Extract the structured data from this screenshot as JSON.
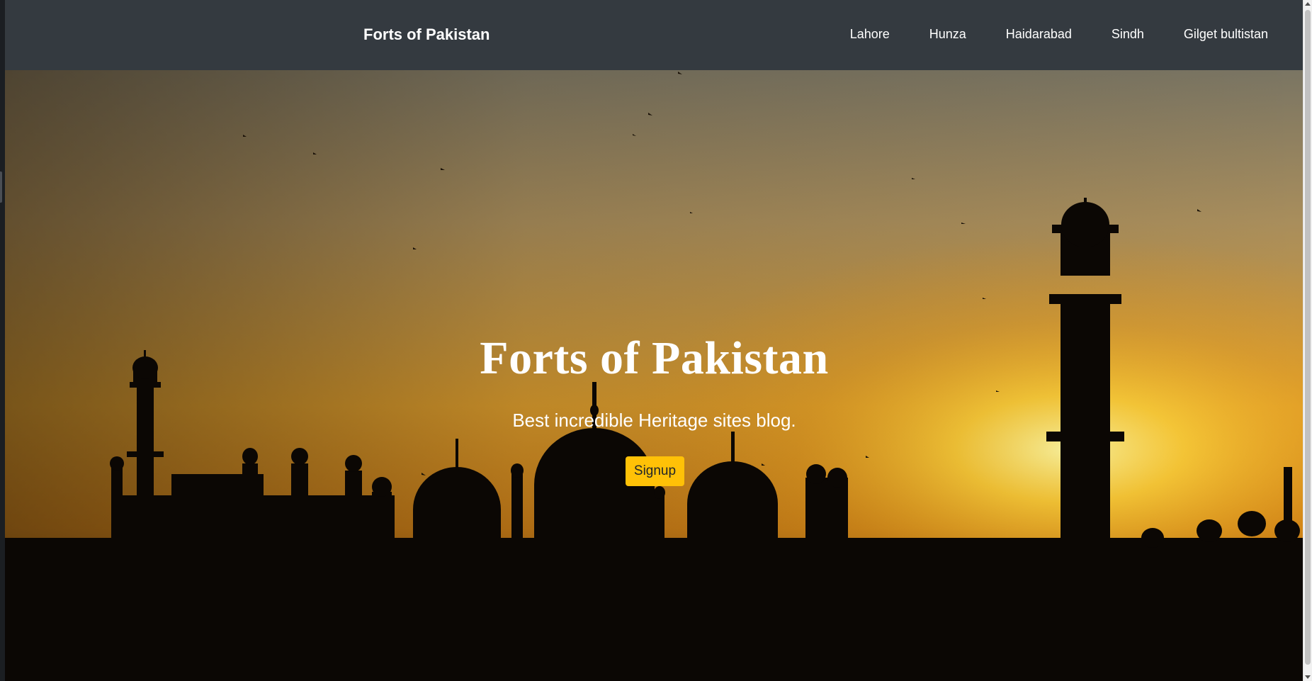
{
  "navbar": {
    "brand": "Forts of Pakistan",
    "links": [
      "Lahore",
      "Hunza",
      "Haidarabad",
      "Sindh",
      "Gilget bultistan"
    ]
  },
  "hero": {
    "title": "Forts of Pakistan",
    "subtitle": "Best incredible Heritage sites blog.",
    "cta_label": "Signup",
    "background_image": "sunset silhouette of mosque domes and minarets"
  },
  "colors": {
    "navbar_bg": "#343a40",
    "cta_bg": "#ffc107",
    "text_light": "#ffffff"
  }
}
